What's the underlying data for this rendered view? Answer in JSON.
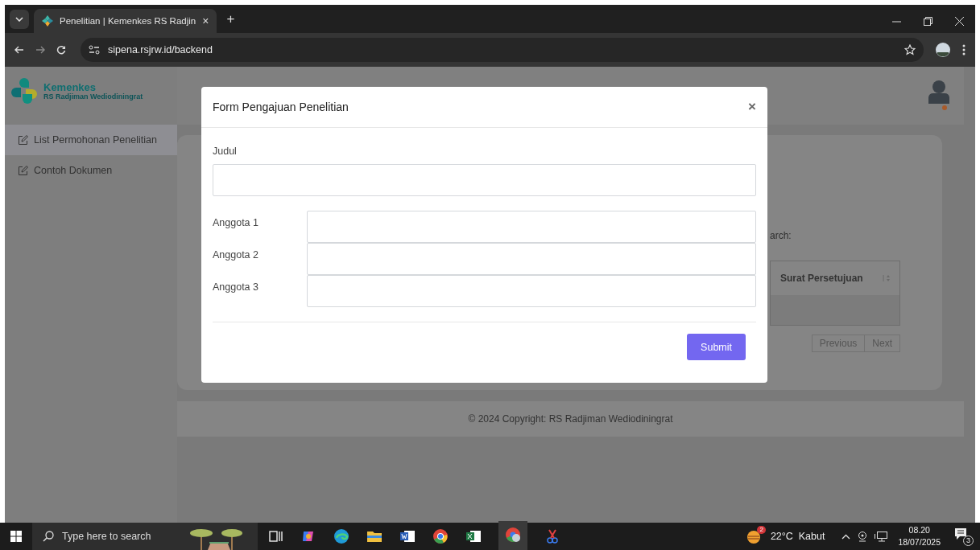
{
  "browser": {
    "tab_title": "Penelitian | Kemenkes RS Radjin",
    "tab_close": "×",
    "new_tab": "+",
    "url": "sipena.rsjrw.id/backend"
  },
  "app": {
    "logo_title": "Kemenkes",
    "logo_subtitle": "RS Radjiman Wediodiningrat",
    "sidebar": [
      {
        "label": "List Permohonan Penelitian",
        "selected": true
      },
      {
        "label": "Contoh Dokumen",
        "selected": false
      }
    ],
    "search_label": "arch:",
    "table_columns": [
      "Surat Persetujuan"
    ],
    "pagination": [
      "Previous",
      "Next"
    ],
    "footer": "© 2024 Copyright: RS Radjiman Wediodiningrat"
  },
  "modal": {
    "title": "Form Pengajuan Penelitian",
    "close": "×",
    "fields": [
      {
        "label": "Judul",
        "kind": "stacked"
      },
      {
        "label": "Anggota 1",
        "kind": "inline"
      },
      {
        "label": "Anggota 2",
        "kind": "inline"
      },
      {
        "label": "Anggota 3",
        "kind": "inline"
      }
    ],
    "submit": "Submit"
  },
  "taskbar": {
    "search_placeholder": "Type here to search",
    "weather_badge": "2",
    "weather": "22°C  Kabut",
    "time": "08.20",
    "date": "18/07/2025",
    "notifications": "3"
  }
}
